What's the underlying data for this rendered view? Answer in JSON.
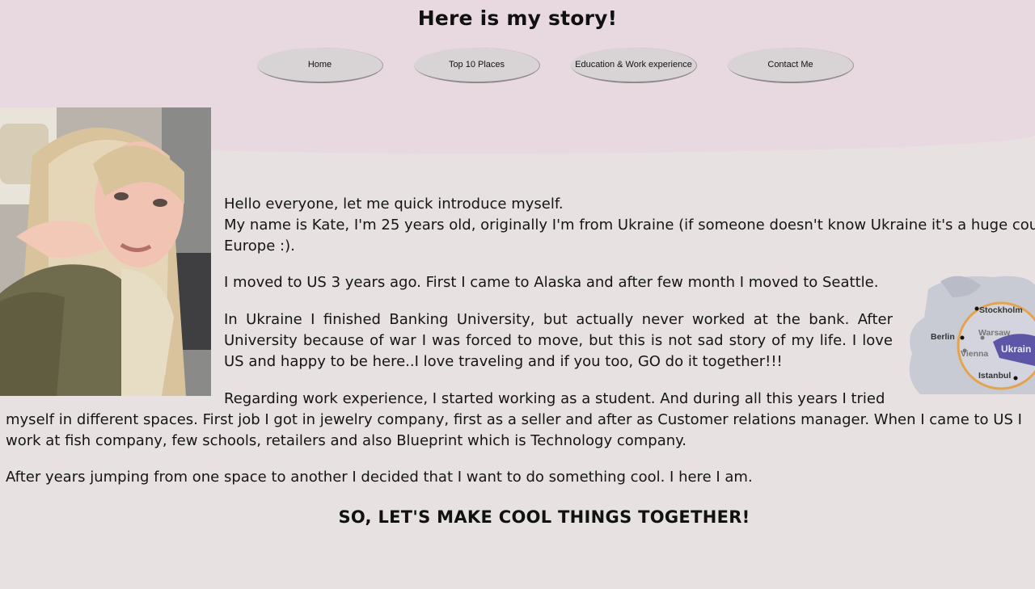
{
  "header": {
    "title": "Here is my story!"
  },
  "nav": {
    "items": [
      {
        "label": "Home"
      },
      {
        "label": "Top 10 Places"
      },
      {
        "label": "Education & Work experience"
      },
      {
        "label": "Contact Me"
      }
    ]
  },
  "intro": {
    "line1": "Hello everyone, let me quick introduce myself.",
    "line2": "My name is Kate, I'm 25 years old, originally I'm from Ukraine (if someone doesn't know Ukraine it's a huge cou",
    "line3": "Europe :)."
  },
  "moved": "I moved to US 3 years ago. First I came to Alaska and after few month I moved to Seattle.",
  "ukraine_para": "In Ukraine I finished Banking University, but actually never worked at the bank. After University because of war I was forced to move, but this is not sad story of my life. I love US and happy to be here..I love traveling and if you too, GO do it together!!!",
  "work": {
    "line1": "Regarding work experience, I started working as a student. And during all this years I tried",
    "line2": "myself in different spaces. First job I got in jewelry company, first as a seller and after as Customer relations manager. When I came to US I",
    "line3": "work at fish company, few schools, retailers and also Blueprint which is Technology company."
  },
  "after": "After years jumping from one space to another I decided that I want to do something cool. I here I am.",
  "cta": "SO, LET'S MAKE COOL THINGS TOGETHER!",
  "map": {
    "labels": [
      "Stockholm",
      "Berlin",
      "Warsaw",
      "Vienna",
      "Ukrain",
      "Istanbul"
    ]
  },
  "colors": {
    "header_bg": "#e8d8df",
    "page_bg": "#e7e1e1",
    "nav_pill": "#d8d4d5",
    "map_highlight": "#5d56a6",
    "map_ring": "#e3a34f"
  }
}
